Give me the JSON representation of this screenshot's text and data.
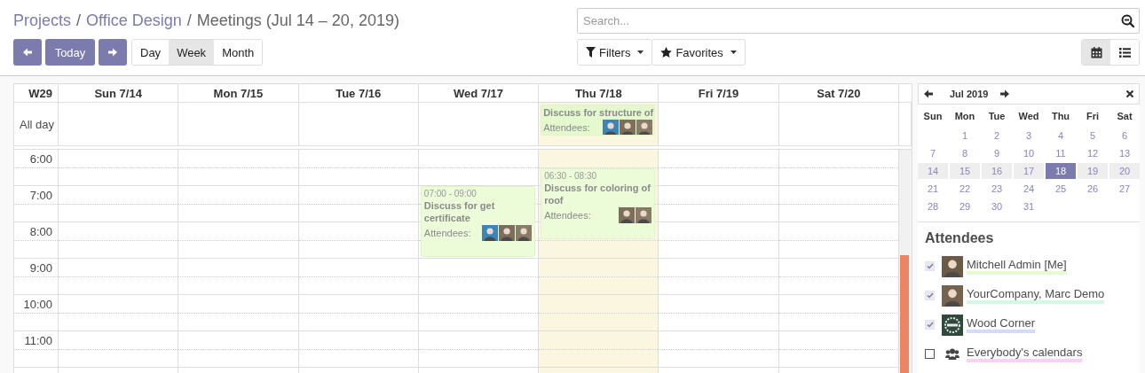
{
  "breadcrumb": [
    {
      "label": "Projects",
      "kind": "link"
    },
    {
      "label": "/",
      "kind": "separator"
    },
    {
      "label": "Office Design",
      "kind": "link"
    },
    {
      "label": "/",
      "kind": "separator"
    },
    {
      "label": "Meetings (Jul 14 – 20, 2019)",
      "kind": "current"
    }
  ],
  "nav_buttons": [
    {
      "kind": "prev"
    },
    {
      "kind": "today",
      "label": "Today"
    },
    {
      "kind": "next"
    }
  ],
  "view_scales": [
    {
      "label": "Day",
      "selected": false
    },
    {
      "label": "Week",
      "selected": true
    },
    {
      "label": "Month",
      "selected": false
    }
  ],
  "search": {
    "placeholder": "Search..."
  },
  "filters": [
    {
      "label": "Filters",
      "kind": "filter"
    },
    {
      "label": "Favorites",
      "kind": "star"
    }
  ],
  "view_switch": [
    {
      "kind": "calendar",
      "selected": true
    },
    {
      "kind": "list",
      "selected": false
    }
  ],
  "calendar": {
    "week_label": "W29",
    "all_day_label": "All day",
    "hours": [
      "6:00",
      "7:00",
      "8:00",
      "9:00",
      "10:00",
      "11:00"
    ],
    "days": [
      {
        "label": "Sun 7/14",
        "today": false
      },
      {
        "label": "Mon 7/15",
        "today": false
      },
      {
        "label": "Tue 7/16",
        "today": false
      },
      {
        "label": "Wed 7/17",
        "today": false,
        "events": [
          {
            "time": "07:00 - 09:00",
            "title": "Discuss for get certificate",
            "attendees_label": "Attendees:",
            "avatars": [
              {
                "color": "#3d85b8"
              },
              {
                "color": "#7d6e5c"
              },
              {
                "color": "#8a7b68"
              }
            ]
          }
        ]
      },
      {
        "label": "Thu 7/18",
        "today": true,
        "all_day_events": [
          {
            "title": "Discuss for structure of",
            "attendees_label": "Attendees:",
            "avatars": [
              {
                "color": "#3d85b8"
              },
              {
                "color": "#7d6e5c"
              },
              {
                "color": "#8a7b68"
              }
            ]
          }
        ],
        "events": [
          {
            "time": "06:30 - 08:30",
            "title": "Discuss for coloring of roof",
            "attendees_label": "Attendees:",
            "avatars": [
              {
                "color": "#7d6e5c"
              },
              {
                "color": "#8a7b68"
              }
            ]
          }
        ]
      },
      {
        "label": "Fri 7/19",
        "today": false
      },
      {
        "label": "Sat 7/20",
        "today": false
      }
    ]
  },
  "mini_calendar": {
    "month": "Jul 2019",
    "weekdays": [
      "Sun",
      "Mon",
      "Tue",
      "Wed",
      "Thu",
      "Fri",
      "Sat"
    ],
    "weeks": [
      {
        "current": false,
        "days": [
          {
            "label": "1",
            "selected": false
          },
          {
            "label": "2",
            "selected": false
          },
          {
            "label": "3",
            "selected": false
          },
          {
            "label": "4",
            "selected": false
          },
          {
            "label": "5",
            "selected": false
          },
          {
            "label": "6",
            "selected": false
          }
        ]
      },
      {
        "current": false,
        "days": [
          {
            "label": "7",
            "selected": false
          },
          {
            "label": "8",
            "selected": false
          },
          {
            "label": "9",
            "selected": false
          },
          {
            "label": "10",
            "selected": false
          },
          {
            "label": "11",
            "selected": false
          },
          {
            "label": "12",
            "selected": false
          },
          {
            "label": "13",
            "selected": false
          }
        ]
      },
      {
        "current": true,
        "days": [
          {
            "label": "14",
            "selected": false
          },
          {
            "label": "15",
            "selected": false
          },
          {
            "label": "16",
            "selected": false
          },
          {
            "label": "17",
            "selected": false
          },
          {
            "label": "18",
            "selected": true
          },
          {
            "label": "19",
            "selected": false
          },
          {
            "label": "20",
            "selected": false
          }
        ]
      },
      {
        "current": false,
        "days": [
          {
            "label": "21",
            "selected": false
          },
          {
            "label": "22",
            "selected": false
          },
          {
            "label": "23",
            "selected": false
          },
          {
            "label": "24",
            "selected": false
          },
          {
            "label": "25",
            "selected": false
          },
          {
            "label": "26",
            "selected": false
          },
          {
            "label": "27",
            "selected": false
          }
        ]
      },
      {
        "current": false,
        "days": [
          {
            "label": "28",
            "selected": false
          },
          {
            "label": "29",
            "selected": false
          },
          {
            "label": "30",
            "selected": false
          },
          {
            "label": "31",
            "selected": false
          }
        ]
      }
    ]
  },
  "attendees": {
    "title": "Attendees",
    "items": [
      {
        "name": "Mitchell Admin [Me]",
        "kind": "person",
        "checked": true,
        "color": "#e5fcd0"
      },
      {
        "name": "YourCompany, Marc Demo",
        "kind": "person",
        "checked": true,
        "color": "#d2f9e6"
      },
      {
        "name": "Wood Corner",
        "kind": "logo",
        "checked": true,
        "color": "#d3dafb"
      },
      {
        "name": "Everybody's calendars",
        "kind": "group",
        "checked": false,
        "color": "#fbd1f5"
      }
    ]
  }
}
